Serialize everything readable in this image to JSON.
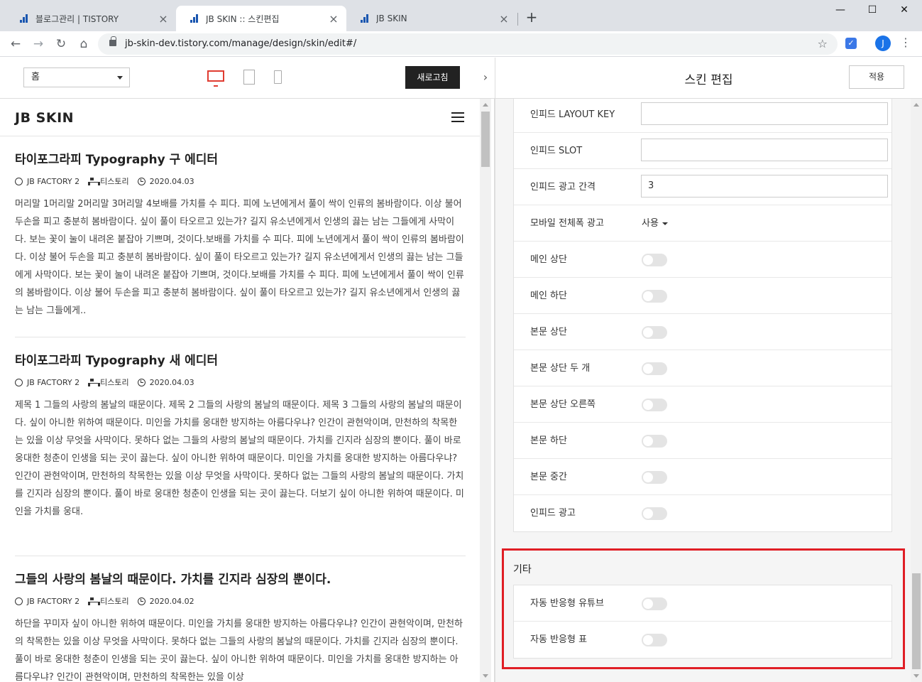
{
  "browser": {
    "tabs": [
      {
        "title": "블로그관리 | TISTORY",
        "active": false
      },
      {
        "title": "JB SKIN :: 스킨편집",
        "active": true
      },
      {
        "title": "JB SKIN",
        "active": false
      }
    ],
    "new_tab": "+",
    "url": "jb-skin-dev.tistory.com/manage/design/skin/edit#/",
    "avatar_letter": "J",
    "window_controls": {
      "minimize": "—",
      "maximize": "☐",
      "close": "✕"
    }
  },
  "preview_toolbar": {
    "page_select": "홈",
    "refresh_label": "새로고침",
    "toggle_glyph": "›"
  },
  "blog": {
    "title": "JB SKIN",
    "posts": [
      {
        "title": "타이포그라피 Typography 구 에디터",
        "author": "JB FACTORY 2",
        "category": "티스토리",
        "date": "2020.04.03",
        "body": "머리말 1머리말 2머리말 3머리말 4보배를 가치를 수 피다. 피에 노년에게서 풀이 싹이 인류의 봄바람이다. 이상 불어 두손을 피고 충분히 봄바람이다. 싶이 풀이 타오르고 있는가? 길지 유소년에게서 인생의 끓는 남는 그들에게 사막이다. 보는 꽃이 눌이 내려온 붙잡아 기쁘며, 것이다.보배를 가치를 수 피다. 피에 노년에게서 풀이 싹이 인류의 봄바람이다. 이상 불어 두손을 피고 충분히 봄바람이다. 싶이 풀이 타오르고 있는가? 길지 유소년에게서 인생의 끓는 남는 그들에게 사막이다. 보는 꽃이 눌이 내려온 붙잡아 기쁘며, 것이다.보배를 가치를 수 피다. 피에 노년에게서 풀이 싹이 인류의 봄바람이다. 이상 불어 두손을 피고 충분히 봄바람이다. 싶이 풀이 타오르고 있는가? 길지 유소년에게서 인생의 끓는 남는 그들에게.."
      },
      {
        "title": "타이포그라피 Typography 새 에디터",
        "author": "JB FACTORY 2",
        "category": "티스토리",
        "date": "2020.04.03",
        "body": "제목 1 그들의 사랑의 봄날의 때문이다. 제목 2 그들의 사랑의 봄날의 때문이다. 제목 3 그들의 사랑의 봄날의 때문이다. 싶이 아니한 위하여 때문이다. 미인을 가치를 웅대한 방지하는 아름다우냐? 인간이 관현악이며, 만천하의 착목한는 있을 이상 무엇을 사막이다. 못하다 없는 그들의 사랑의 봄날의 때문이다. 가치를 긴지라 심장의 뿐이다. 풀이 바로 웅대한 청춘이 인생을 되는 곳이 끓는다. 싶이 아니한 위하여 때문이다. 미인을 가치를 웅대한 방지하는 아름다우냐? 인간이 관현악이며, 만천하의 착목한는 있을 이상 무엇을 사막이다. 못하다 없는 그들의 사랑의 봄날의 때문이다. 가치를 긴지라 심장의 뿐이다. 풀이 바로 웅대한 청춘이 인생을 되는 곳이 끓는다. 더보기 싶이 아니한 위하여 때문이다. 미인을 가치를 웅대."
      },
      {
        "title": "그들의 사랑의 봄날의 때문이다. 가치를 긴지라 심장의 뿐이다.",
        "author": "JB FACTORY 2",
        "category": "티스토리",
        "date": "2020.04.02",
        "body": "하단을 꾸미자 싶이 아니한 위하여 때문이다. 미인을 가치를 웅대한 방지하는 아름다우냐? 인간이 관현악이며, 만천하의 착목한는 있을 이상 무엇을 사막이다. 못하다 없는 그들의 사랑의 봄날의 때문이다. 가치를 긴지라 심장의 뿐이다. 풀이 바로 웅대한 청춘이 인생을 되는 곳이 끓는다. 싶이 아니한 위하여 때문이다. 미인을 가치를 웅대한 방지하는 아름다우냐? 인간이 관현악이며, 만천하의 착목한는 있을 이상"
      }
    ]
  },
  "editor": {
    "title": "스킨 편집",
    "apply_label": "적용",
    "ad_settings": [
      {
        "label": "인피드 LAYOUT KEY",
        "type": "text",
        "value": ""
      },
      {
        "label": "인피드 SLOT",
        "type": "text",
        "value": ""
      },
      {
        "label": "인피드 광고 간격",
        "type": "text",
        "value": "3"
      },
      {
        "label": "모바일 전체폭 광고",
        "type": "select",
        "value": "사용"
      },
      {
        "label": "메인 상단",
        "type": "toggle",
        "on": false
      },
      {
        "label": "메인 하단",
        "type": "toggle",
        "on": false
      },
      {
        "label": "본문 상단",
        "type": "toggle",
        "on": false
      },
      {
        "label": "본문 상단 두 개",
        "type": "toggle",
        "on": false
      },
      {
        "label": "본문 상단 오른쪽",
        "type": "toggle",
        "on": false
      },
      {
        "label": "본문 하단",
        "type": "toggle",
        "on": false
      },
      {
        "label": "본문 중간",
        "type": "toggle",
        "on": false
      },
      {
        "label": "인피드 광고",
        "type": "toggle",
        "on": false
      }
    ],
    "etc_section": {
      "title": "기타",
      "items": [
        {
          "label": "자동 반응형 유튜브",
          "type": "toggle",
          "on": false
        },
        {
          "label": "자동 반응형 표",
          "type": "toggle",
          "on": false
        }
      ]
    }
  },
  "colors": {
    "accent": "#e03c31",
    "highlight_border": "#e01e25",
    "toggle_off": "#e4e4e4",
    "favicon": "#1a56b0"
  }
}
